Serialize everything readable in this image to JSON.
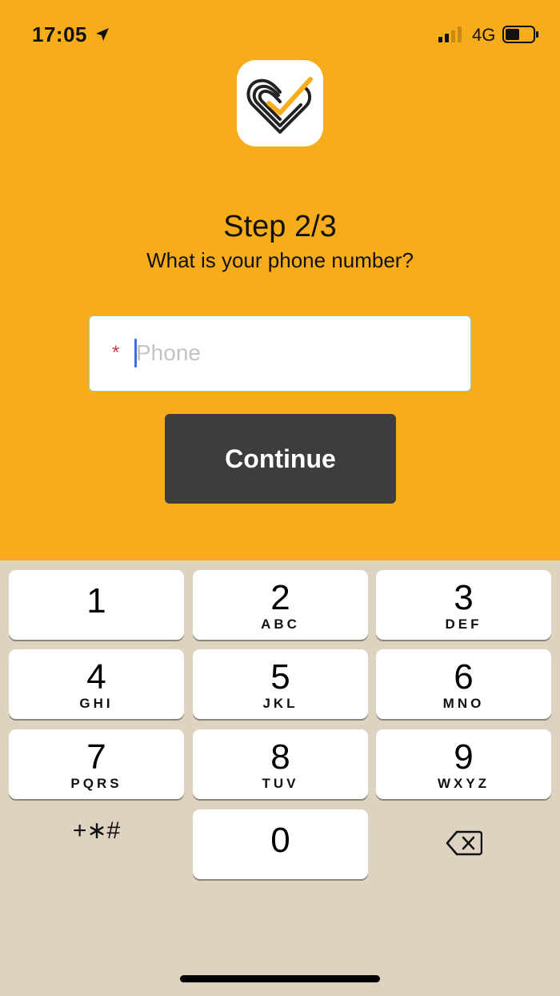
{
  "status_bar": {
    "time": "17:05",
    "network": "4G",
    "icons": [
      "location-arrow-icon",
      "signal-icon",
      "battery-icon"
    ]
  },
  "colors": {
    "background": "#F7AC1C",
    "button": "#3D3D3D",
    "keypad_background": "#DDD3C0",
    "required_star": "#D9364A",
    "caret": "#3D6CF0"
  },
  "header": {
    "logo_icon": "heart-check-logo-icon",
    "step_title": "Step 2/3",
    "step_subtitle": "What is your phone number?"
  },
  "form": {
    "required_marker": "*",
    "phone_placeholder": "Phone",
    "phone_value": "",
    "continue_label": "Continue"
  },
  "keypad": {
    "keys": [
      {
        "digit": "1",
        "letters": ""
      },
      {
        "digit": "2",
        "letters": "ABC"
      },
      {
        "digit": "3",
        "letters": "DEF"
      },
      {
        "digit": "4",
        "letters": "GHI"
      },
      {
        "digit": "5",
        "letters": "JKL"
      },
      {
        "digit": "6",
        "letters": "MNO"
      },
      {
        "digit": "7",
        "letters": "PQRS"
      },
      {
        "digit": "8",
        "letters": "TUV"
      },
      {
        "digit": "9",
        "letters": "WXYZ"
      },
      {
        "digit": "0",
        "letters": ""
      }
    ],
    "symbols_label": "+∗#",
    "delete_icon": "backspace-icon"
  }
}
